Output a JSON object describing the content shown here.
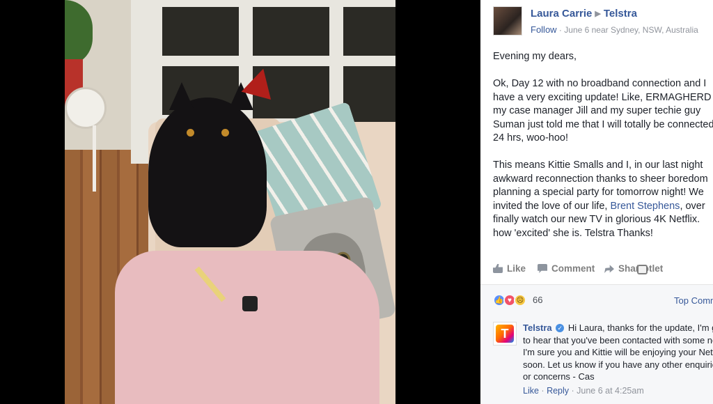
{
  "post": {
    "author": "Laura Carrie",
    "target_page": "Telstra",
    "follow_label": "Follow",
    "meta": "June 6 near Sydney, NSW, Australia",
    "body_p1": "Evening my dears,",
    "body_p2_lines": [
      "Ok, Day 12 with no broadband connection and I",
      "have a very exciting update! Like, ERMAGHERD",
      "my case manager Jill and my super techie guy",
      "Suman just told me that I will totally be connected",
      "24 hrs, woo-hoo!"
    ],
    "body_p3_lines": [
      "This means Kittie Smalls and I, in our last night",
      "awkward reconnection thanks to sheer boredom",
      "planning a special party for tomorrow night! We",
      "invited the love of our life, "
    ],
    "mention": "Brent Stephens",
    "body_p3_after_mention": ", over",
    "body_p3_tail_lines": [
      "finally watch our new TV in glorious 4K Netflix.",
      "how 'excited' she is. Telstra Thanks!"
    ]
  },
  "actions": {
    "like": "Like",
    "comment": "Comment",
    "share": "Share",
    "hotlet": "Hotlet"
  },
  "reactions": {
    "count": "66",
    "top_comments": "Top Comments"
  },
  "comment": {
    "author": "Telstra",
    "lines": [
      "Hi Laura, thanks for the update, I'm glad",
      "to hear that you've been contacted with some news.",
      "I'm sure you and Kittie will be enjoying your Netflix",
      "soon. Let us know if you have any other enquiries",
      "or concerns - Cas"
    ],
    "like": "Like",
    "reply": "Reply",
    "time": "June 6 at 4:25am"
  },
  "colors": {
    "link": "#365899",
    "meta": "#90949c",
    "text": "#1d2129"
  }
}
